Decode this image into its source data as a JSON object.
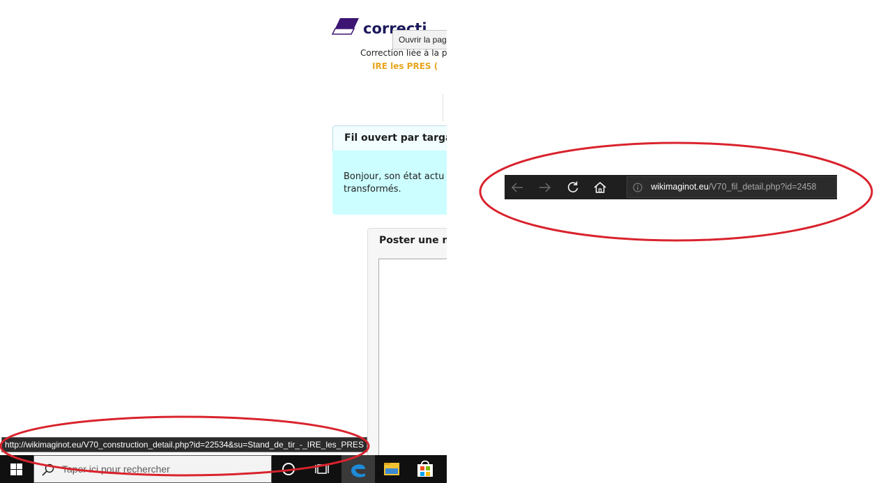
{
  "webpage": {
    "site_title": "correcti",
    "tooltip_text": "Ouvrir la pag",
    "subline": "Correction liée à la p",
    "orange_link": "IRE les PRES   (",
    "thread_header": "Fil ouvert par targa",
    "thread_body": "Bonjour, son état actu\ntransformés.",
    "post_header": "Poster une n",
    "status_url": "http://wikimaginot.eu/V70_construction_detail.php?id=22534&su=Stand_de_tir_-_IRE_les_PRES"
  },
  "taskbar": {
    "search_placeholder": "Taper ici pour rechercher"
  },
  "browser": {
    "url_domain": "wikimaginot.eu",
    "url_path": "/V70_fil_detail.php?id=2458"
  },
  "colors": {
    "annotation": "#d9232d",
    "logo": "#3c1573",
    "site_title": "#1c1a5c",
    "orange_link": "#e8a51e",
    "thread_bg": "#ccfdff",
    "browser_bg": "#1f1f1f"
  },
  "icons": [
    "eraser-logo-icon",
    "windows-start-icon",
    "search-icon",
    "cortana-icon",
    "task-view-icon",
    "edge-icon",
    "file-explorer-icon",
    "store-icon",
    "back-arrow-icon",
    "forward-arrow-icon",
    "refresh-icon",
    "home-icon",
    "info-icon"
  ]
}
